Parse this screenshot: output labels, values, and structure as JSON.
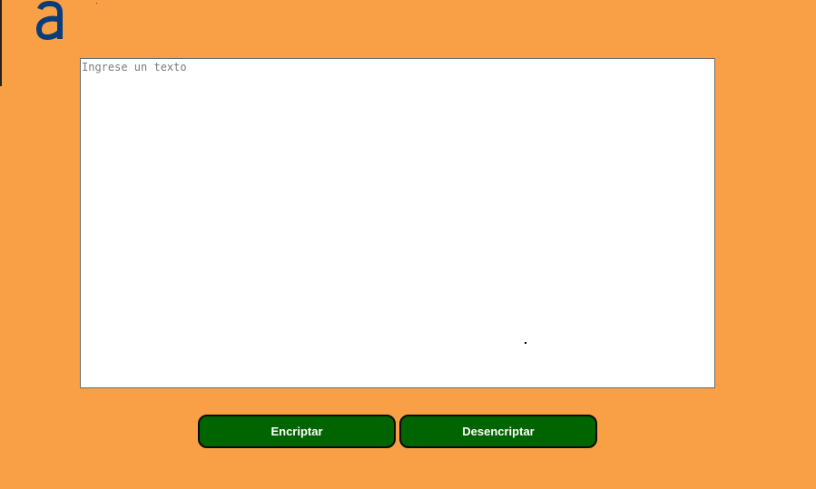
{
  "logo": {
    "icon": "letter-a-logo",
    "color": "#0a3d7a"
  },
  "editor": {
    "placeholder": "Ingrese un texto",
    "value": ""
  },
  "actions": {
    "encrypt_label": "Encriptar",
    "decrypt_label": "Desencriptar"
  },
  "colors": {
    "background": "#f9a046",
    "button": "#006400",
    "button_text": "#ffffff"
  }
}
